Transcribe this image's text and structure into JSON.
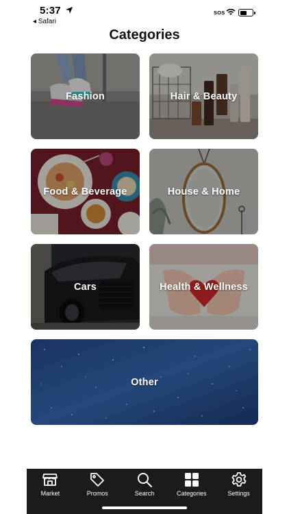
{
  "status_bar": {
    "time": "5:37",
    "back_app": "◂ Safari",
    "sos": "SOS",
    "battery_level": 0.6
  },
  "page": {
    "title": "Categories"
  },
  "categories": [
    {
      "label": "Fashion",
      "image": "sneakers-photo"
    },
    {
      "label": "Hair & Beauty",
      "image": "cosmetics-basket-photo"
    },
    {
      "label": "Food & Beverage",
      "image": "dining-table-photo"
    },
    {
      "label": "House & Home",
      "image": "round-mirror-photo"
    },
    {
      "label": "Cars",
      "image": "dark-car-photo"
    },
    {
      "label": "Health & Wellness",
      "image": "hands-heart-photo"
    },
    {
      "label": "Other",
      "image": "starry-sky-photo"
    }
  ],
  "tab_bar": {
    "tabs": [
      {
        "label": "Market",
        "icon": "storefront-icon"
      },
      {
        "label": "Promos",
        "icon": "tag-icon"
      },
      {
        "label": "Search",
        "icon": "search-icon"
      },
      {
        "label": "Categories",
        "icon": "grid-icon"
      },
      {
        "label": "Settings",
        "icon": "gear-icon"
      }
    ],
    "background": "#1b1b1b"
  }
}
